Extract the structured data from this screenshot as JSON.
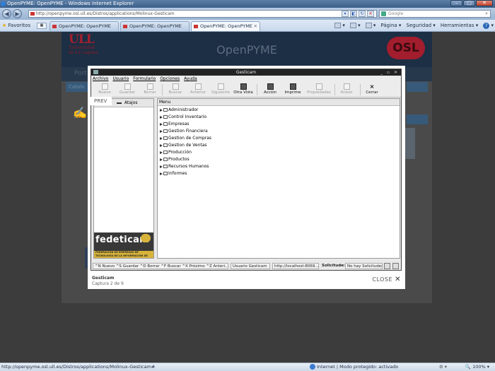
{
  "browser": {
    "window_title": "OpenPYME: OpenPYME - Windows Internet Explorer",
    "address": "http://openpyme.osl.ull.es/Distros/applications/Molinux-Gesticam",
    "search_placeholder": "Google",
    "favorites_label": "Favoritos",
    "tabs": [
      {
        "label": "OpenPYME: OpenPYME"
      },
      {
        "label": "OpenPYME: OpenPYME"
      },
      {
        "label": "OpenPYME: OpenPYME"
      }
    ],
    "commands": {
      "page": "Página",
      "safety": "Seguridad",
      "tools": "Herramientas"
    },
    "status_url": "http://openpyme.osl.ull.es/Distros/applications/Molinux-Gesticam#",
    "status_zone": "Internet | Modo protegido: activado",
    "zoom": "100%"
  },
  "site": {
    "title": "OpenPYME",
    "ull_mark": "ULL",
    "ull_name_1": "Universidad",
    "ull_name_2": "de La Laguna",
    "osl_mark": "OSL",
    "nav_label": "Port",
    "catalog_label": "Catalo"
  },
  "lightbox": {
    "prev_label": "PREV",
    "caption_title": "Gesticam",
    "caption_count": "Captura 2 de 9",
    "close_label": "CLOSE"
  },
  "gesticam": {
    "window_title": "Gesticam",
    "menu": [
      "Archivo",
      "Usuario",
      "Formulario",
      "Opciones",
      "Ayuda"
    ],
    "toolbar": [
      {
        "label": "Nuevo",
        "enabled": false
      },
      {
        "label": "Guardar",
        "enabled": false
      },
      {
        "label": "Borrar",
        "enabled": false
      },
      {
        "label": "Buscar",
        "enabled": false
      },
      {
        "label": "Anterior",
        "enabled": false
      },
      {
        "label": "Siguiente",
        "enabled": false
      },
      {
        "label": "Otra Vista",
        "enabled": true
      },
      {
        "label": "Acción",
        "enabled": true
      },
      {
        "label": "Imprime",
        "enabled": true
      },
      {
        "label": "Propiedades",
        "enabled": false
      },
      {
        "label": "Anexo",
        "enabled": false
      },
      {
        "label": "Cerrar",
        "enabled": true
      }
    ],
    "shortcuts_label": "Atajos",
    "tree_header": "Menu",
    "tree_items": [
      "Administrador",
      "Control Inventario",
      "Empresas",
      "Gestion Financiera",
      "Gestion de Compras",
      "Gestion de Ventas",
      "Producción",
      "Productos",
      "Recursos Humanos",
      "Informes"
    ],
    "sponsor_logo": "fedeticam",
    "sponsor_strip": "FEDERACIÓN DE EMPRESAS DE TECNOLOGÍA DE LA INFORMACIÓN DE CASTILLA LA MANCHA",
    "status": {
      "shortcuts": "^N Nuevo ^S Guardar ^D Borrar ^F Buscar ^X Próximo ^Z Anteri...",
      "user": "Usuario Gesticam",
      "server": "http://localhost:8069...",
      "requests_label": "Solicitudes",
      "requests_value": "No hay Solicitudes"
    }
  }
}
